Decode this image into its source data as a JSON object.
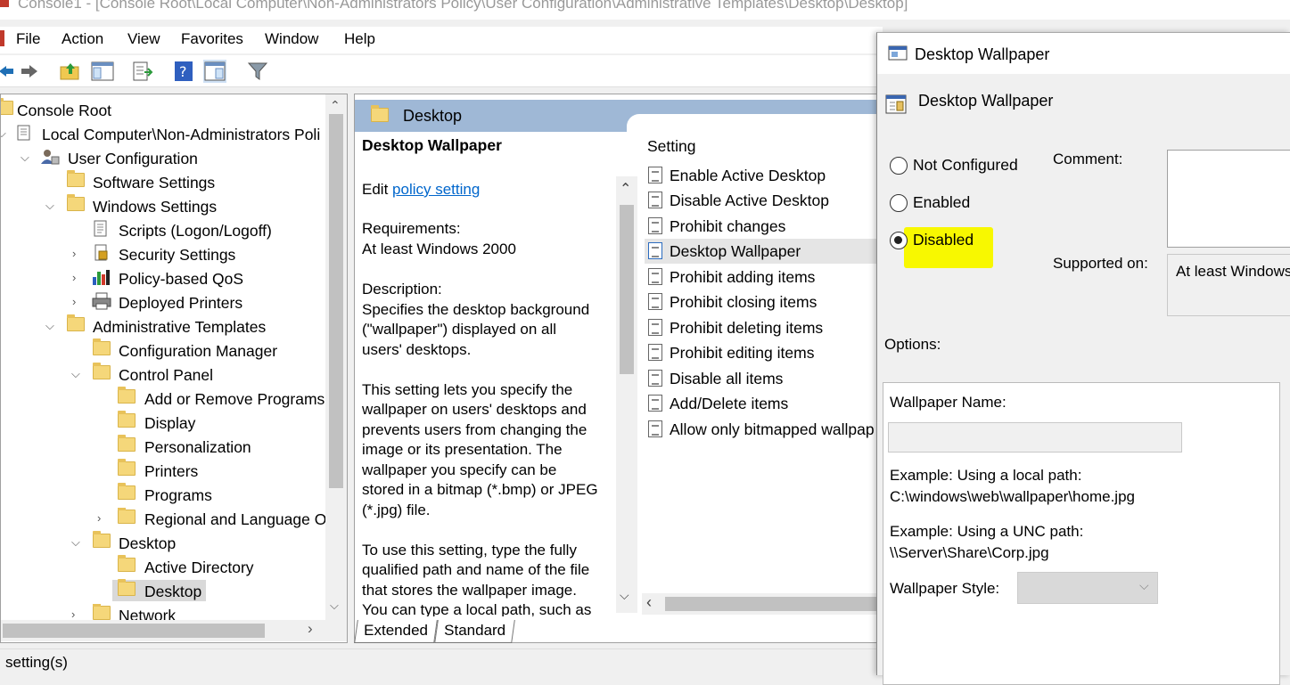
{
  "window": {
    "title": "Console1 - [Console Root\\Local Computer\\Non-Administrators Policy\\User Configuration\\Administrative Templates\\Desktop\\Desktop]"
  },
  "menu": [
    "File",
    "Action",
    "View",
    "Favorites",
    "Window",
    "Help"
  ],
  "toolbar": [
    "back-icon",
    "forward-icon",
    "up-folder-icon",
    "show-hide-tree-icon",
    "export-list-icon",
    "help-icon",
    "properties-icon",
    "filter-icon"
  ],
  "tree": {
    "items": [
      {
        "label": "Console Root"
      },
      {
        "label": "Local Computer\\Non-Administrators Poli"
      },
      {
        "label": "User Configuration"
      },
      {
        "label": "Software Settings"
      },
      {
        "label": "Windows Settings"
      },
      {
        "label": "Scripts (Logon/Logoff)"
      },
      {
        "label": "Security Settings"
      },
      {
        "label": "Policy-based QoS"
      },
      {
        "label": "Deployed Printers"
      },
      {
        "label": "Administrative Templates"
      },
      {
        "label": "Configuration Manager"
      },
      {
        "label": "Control Panel"
      },
      {
        "label": "Add or Remove Programs"
      },
      {
        "label": "Display"
      },
      {
        "label": "Personalization"
      },
      {
        "label": "Printers"
      },
      {
        "label": "Programs"
      },
      {
        "label": "Regional and Language O"
      },
      {
        "label": "Desktop"
      },
      {
        "label": "Active Directory"
      },
      {
        "label": "Desktop"
      },
      {
        "label": "Network"
      }
    ]
  },
  "details": {
    "header": "Desktop",
    "policy_title": "Desktop Wallpaper",
    "edit_prefix": "Edit",
    "edit_link": "policy setting",
    "requirements_label": "Requirements:",
    "requirements_value": "At least Windows 2000",
    "description_label": "Description:",
    "description_lines": [
      "Specifies the desktop background",
      "(\"wallpaper\") displayed on all",
      "users' desktops.",
      "",
      "This setting lets you specify the",
      "wallpaper on users' desktops and",
      "prevents users from changing the",
      "image or its presentation. The",
      "wallpaper you specify can be",
      "stored in a bitmap (*.bmp) or JPEG",
      "(*.jpg) file.",
      "",
      "To use this setting, type the fully",
      "qualified path and name of the file",
      "that stores the wallpaper image.",
      "You can type a local path, such as"
    ],
    "settings_header": "Setting",
    "settings": [
      "Enable Active Desktop",
      "Disable Active Desktop",
      "Prohibit changes",
      "Desktop Wallpaper",
      "Prohibit adding items",
      "Prohibit closing items",
      "Prohibit deleting items",
      "Prohibit editing items",
      "Disable all items",
      "Add/Delete items",
      "Allow only bitmapped wallpap"
    ],
    "selected_setting": "Desktop Wallpaper"
  },
  "tabs": [
    "Extended",
    "Standard"
  ],
  "status": "setting(s)",
  "dialog": {
    "title": "Desktop Wallpaper",
    "heading": "Desktop Wallpaper",
    "radios": [
      "Not Configured",
      "Enabled",
      "Disabled"
    ],
    "selected_radio": "Disabled",
    "comment_label": "Comment:",
    "supported_label": "Supported on:",
    "supported_value": "At least Windows",
    "options_label": "Options:",
    "wallpaper_name_label": "Wallpaper Name:",
    "wallpaper_name_value": "",
    "example_local_label": "Example: Using a local path:",
    "example_local_value": "C:\\windows\\web\\wallpaper\\home.jpg",
    "example_unc_label": "Example: Using a UNC path:",
    "example_unc_value": "\\\\Server\\Share\\Corp.jpg",
    "wallpaper_style_label": "Wallpaper Style:",
    "wallpaper_style_value": "",
    "highlight_color": "#f8f800"
  }
}
